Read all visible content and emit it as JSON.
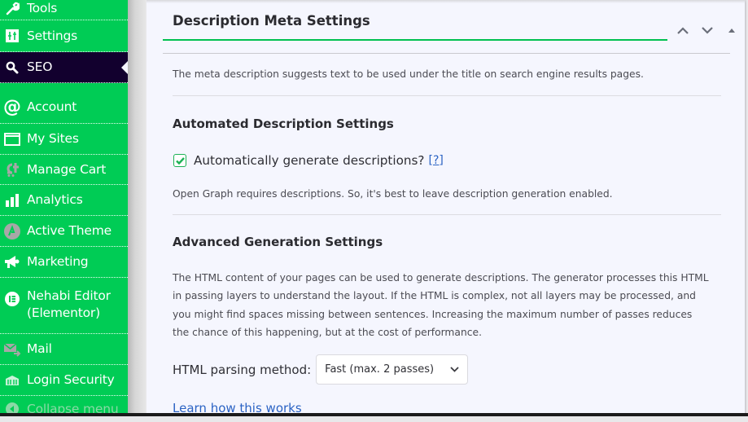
{
  "sidebar": {
    "items": [
      {
        "label": "Tools",
        "icon": "wrench-icon"
      },
      {
        "label": "Settings",
        "icon": "settings-sliders-icon"
      },
      {
        "label": "SEO",
        "icon": "search-icon",
        "active": true
      },
      {
        "label": "Account",
        "icon": "at-sign-icon"
      },
      {
        "label": "My Sites",
        "icon": "window-icon"
      },
      {
        "label": "Manage Cart",
        "icon": "cart-icon"
      },
      {
        "label": "Analytics",
        "icon": "bar-chart-icon"
      },
      {
        "label": "Active Theme",
        "icon": "theme-icon"
      },
      {
        "label": "Marketing",
        "icon": "megaphone-icon"
      },
      {
        "label": "Nehabi Editor (Elementor)",
        "icon": "elementor-icon"
      },
      {
        "label": "Mail",
        "icon": "mail-icon"
      },
      {
        "label": "Login Security",
        "icon": "security-icon"
      },
      {
        "label": "Collapse menu",
        "icon": "collapse-icon"
      }
    ]
  },
  "box": {
    "title": "Description Meta Settings",
    "controls": {
      "move_up": "Move up",
      "move_down": "Move down",
      "toggle": "Toggle panel"
    },
    "intro": "The meta description suggests text to be used under the title on search engine results pages.",
    "automated": {
      "heading": "Automated Description Settings",
      "checkbox_label": "Automatically generate descriptions?",
      "checkbox_checked": true,
      "help_link": "[?]",
      "note": "Open Graph requires descriptions. So, it's best to leave description generation enabled."
    },
    "advanced": {
      "heading": "Advanced Generation Settings",
      "paragraph": "The HTML content of your pages can be used to generate descriptions. The generator processes this HTML in passing layers to understand the layout. If the HTML is complex, not all layers may be processed, and you might find spaces missing between sentences. Increasing the maximum number of passes reduces the chance of this happening, but at the cost of performance.",
      "parsing_label": "HTML parsing method:",
      "parsing_value": "Fast (max. 2 passes)",
      "learn_link": "Learn how this works"
    }
  },
  "colors": {
    "sidebar_bg": "#00cc55",
    "sidebar_active_bg": "#12002e",
    "accent_green": "#00c050",
    "link_blue": "#2b63c4"
  }
}
